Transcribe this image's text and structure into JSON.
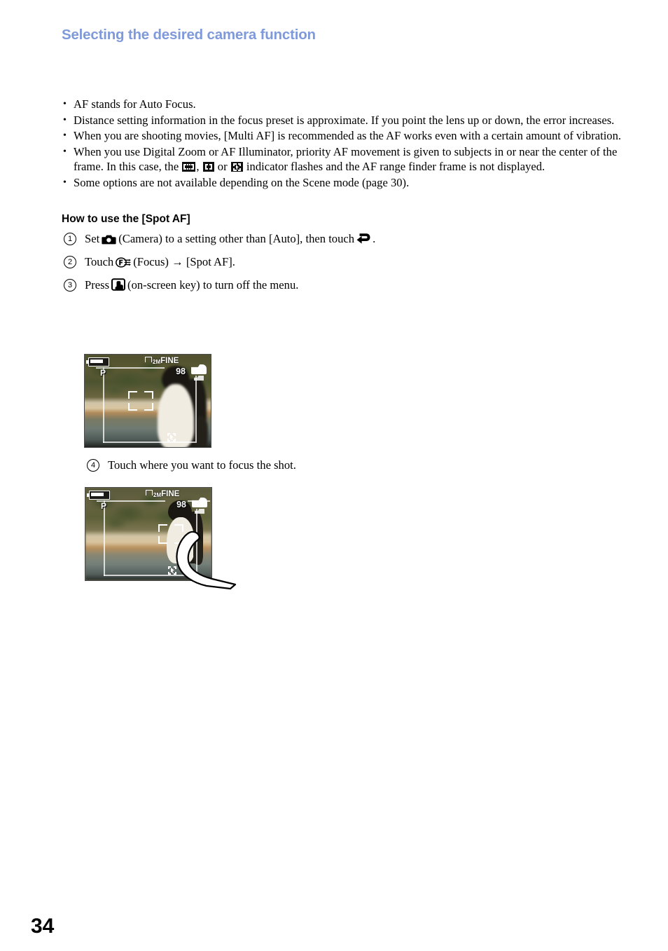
{
  "header": {
    "running_head": "Selecting the desired camera function",
    "color": "#7f9ada"
  },
  "notes": [
    {
      "text": "AF stands for Auto Focus."
    },
    {
      "text": "Distance setting information in the focus preset is approximate. If you point the lens up or down, the error increases."
    },
    {
      "text": "When you are shooting movies, [Multi AF] is recommended as the AF works even with a certain amount of vibration."
    },
    {
      "text_before": "When you use Digital Zoom or AF Illuminator, priority AF movement is given to subjects in or near the center of the frame. In this case, the ",
      "icon_1": "multi-af-indicator-icon",
      "text_mid_1": ", ",
      "icon_2": "center-af-indicator-icon",
      "text_mid_2": " or ",
      "icon_3": "spot-af-indicator-icon",
      "text_after": " indicator flashes and the AF range finder frame is not displayed."
    },
    {
      "text": "Some options are not available depending on the Scene mode (page 30)."
    }
  ],
  "section": {
    "heading": "How to use the [Spot AF]",
    "steps": [
      {
        "number": "1",
        "part_1": "Set",
        "icon_1": "camera-mode-icon",
        "part_2": "(Camera) to a setting other than [Auto], then touch",
        "icon_2": "return-arrow-icon",
        "part_3": "."
      },
      {
        "number": "2",
        "part_1": "Touch",
        "icon_1": "focus-icon",
        "part_2": "(Focus)",
        "arrow": "→",
        "part_3": "[Spot AF]."
      },
      {
        "number": "3",
        "part_1": "Press",
        "icon_1": "on-screen-key-icon",
        "part_2": "(on-screen key) to turn off the menu."
      },
      {
        "number": "4",
        "part_1": "Touch where you want to focus the shot."
      }
    ]
  },
  "figures": [
    {
      "name": "spot-af-frame-screenshot",
      "osd": {
        "battery": "battery-full-icon",
        "mode": "P",
        "image_size": "2M",
        "quality": "FINE",
        "shots_remaining": "98",
        "media_icon": "recording-media-icon",
        "af_frame": "af-range-finder-frame",
        "status_icon": "spot-af-status-icon"
      }
    },
    {
      "name": "spot-af-touch-screenshot",
      "osd": {
        "battery": "battery-full-icon",
        "mode": "P",
        "image_size": "2M",
        "quality": "FINE",
        "shots_remaining": "98",
        "media_icon": "recording-media-icon",
        "af_frame": "af-range-finder-frame",
        "status_icon": "spot-af-status-icon"
      },
      "overlay": "finger-touch-illustration"
    }
  ],
  "folio": {
    "page_number": "34"
  }
}
